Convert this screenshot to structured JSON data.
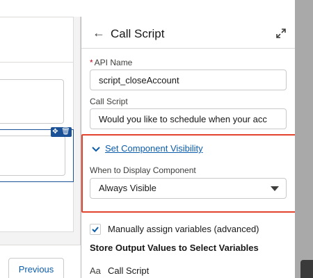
{
  "canvas": {
    "previous_label": "Previous"
  },
  "panel": {
    "title": "Call Script",
    "api_name_label": "API Name",
    "api_name_value": "script_closeAccount",
    "call_script_label": "Call Script",
    "call_script_value": "Would you like to schedule when your acc",
    "visibility_section_label": "Set Component Visibility",
    "when_display_label": "When to Display Component",
    "when_display_value": "Always Visible",
    "manual_assign_label": "Manually assign variables (advanced)",
    "manual_assign_checked": true,
    "store_output_heading": "Store Output Values to Select Variables",
    "output_type_icon": "Aa",
    "output_field_label": "Call Script"
  },
  "colors": {
    "accent": "#0b5cab",
    "highlight_border": "#e3422d",
    "selected_border": "#1b5297",
    "required": "#ba0517"
  },
  "icons": {
    "back": "arrow-left-icon",
    "expand": "expand-icon",
    "chevron": "chevron-down-icon",
    "check": "checkmark-icon",
    "dropdown": "caret-down-icon",
    "move": "move-icon",
    "delete": "trash-icon",
    "text_type": "text-type-icon"
  }
}
